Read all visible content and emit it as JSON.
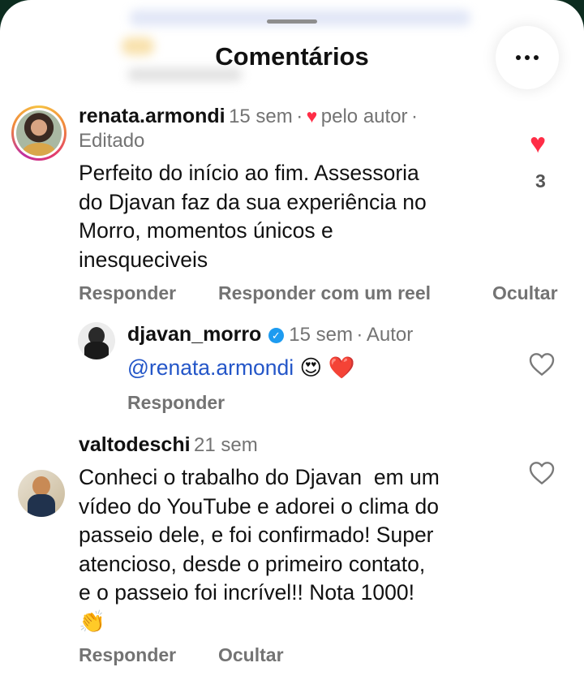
{
  "sheet": {
    "title": "Comentários"
  },
  "comments": [
    {
      "username": "renata.armondi",
      "time": "15 sem",
      "sep1": "·",
      "liked_by_author_icon": "red-heart-icon",
      "liked_by_author_label": "pelo autor",
      "sep2": "·",
      "edited": "Editado",
      "text_lines": [
        "Perfeito do início ao fim. Assessoria",
        "do Djavan faz da sua experiência no",
        "Morro, momentos únicos e",
        "inesqueciveis"
      ],
      "actions": [
        "Responder",
        "Responder com um reel",
        "Ocultar"
      ],
      "like_icon": "red-heart-icon",
      "like_count": "3"
    },
    {
      "username": "djavan_morro",
      "verified_icon": "verified-badge-icon",
      "time": "15 sem",
      "sep": "·",
      "author_label": "Autor",
      "mention": "@renata.armondi",
      "emojis": "😍 ❤️",
      "actions": [
        "Responder"
      ],
      "like_icon": "outline-heart-icon"
    },
    {
      "username": "valtodeschi",
      "time": "21 sem",
      "text_lines": [
        "Conheci o trabalho do Djavan  em um",
        "vídeo do YouTube e adorei o clima do",
        "passeio dele, e foi confirmado! Super",
        "atencioso, desde o primeiro contato,",
        "e o passeio foi incrível!! Nota 1000!",
        "👏"
      ],
      "actions": [
        "Responder",
        "Ocultar"
      ],
      "like_icon": "outline-heart-icon"
    }
  ],
  "colors": {
    "accent_link": "#2456c8",
    "heart": "#ff2d46",
    "muted": "#737373"
  }
}
